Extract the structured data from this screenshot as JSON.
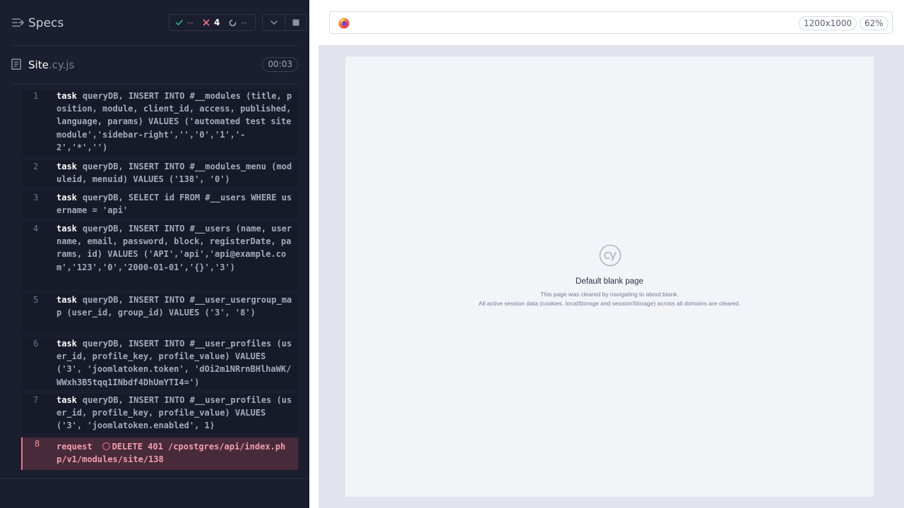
{
  "reporter": {
    "title": "Specs",
    "stats": {
      "passed": "--",
      "failed": "4",
      "pending": "--"
    },
    "spec": {
      "name_base": "Site",
      "name_ext": ".cy.js",
      "duration": "00:03"
    },
    "commands": [
      {
        "num": "1",
        "kw": "task",
        "msg": "queryDB, INSERT INTO #__modules (title, position, module, client_id, access, published, language, params) VALUES ('automated test site module','sidebar-right','','0','1','-2','*','')"
      },
      {
        "num": "2",
        "kw": "task",
        "msg": "queryDB, INSERT INTO #__modules_menu (moduleid, menuid) VALUES ('138', '0')"
      },
      {
        "num": "3",
        "kw": "task",
        "msg": "queryDB, SELECT id FROM #__users WHERE username = 'api'"
      },
      {
        "num": "4",
        "kw": "task",
        "msg": "queryDB, INSERT INTO #__users (name, username, email, password, block, registerDate, params, id) VALUES ('API','api','api@example.com','123','0','2000-01-01','{}','3')"
      },
      {
        "num": "5",
        "kw": "task",
        "msg": "queryDB, INSERT INTO #__user_usergroup_map (user_id, group_id) VALUES ('3', '8')"
      },
      {
        "num": "6",
        "kw": "task",
        "msg": "queryDB, INSERT INTO #__user_profiles (user_id, profile_key, profile_value) VALUES ('3', 'joomlatoken.token', 'dOi2m1NRrnBHlhaWK/WWxh3B5tqq1INbdf4DhUmYTI4=')"
      },
      {
        "num": "7",
        "kw": "task",
        "msg": "queryDB, INSERT INTO #__user_profiles (user_id, profile_key, profile_value) VALUES ('3', 'joomlatoken.enabled', 1)"
      },
      {
        "num": "8",
        "kw": "request",
        "msg": "DELETE 401 /cpostgres/api/index.php/v1/modules/site/138",
        "state": "failed"
      }
    ]
  },
  "aut": {
    "viewport_size": "1200x1000",
    "zoom": "62%",
    "blank_page": {
      "title": "Default blank page",
      "line1": "This page was cleared by navigating to about:blank.",
      "line2": "All active session data (cookies, localStorage and sessionStorage) across all domains are cleared."
    }
  },
  "colors": {
    "reporter_bg": "#1b1e2e",
    "fail_accent": "#e47a8e",
    "pass_accent": "#1fa971",
    "aut_bg": "#e1e3ed"
  }
}
